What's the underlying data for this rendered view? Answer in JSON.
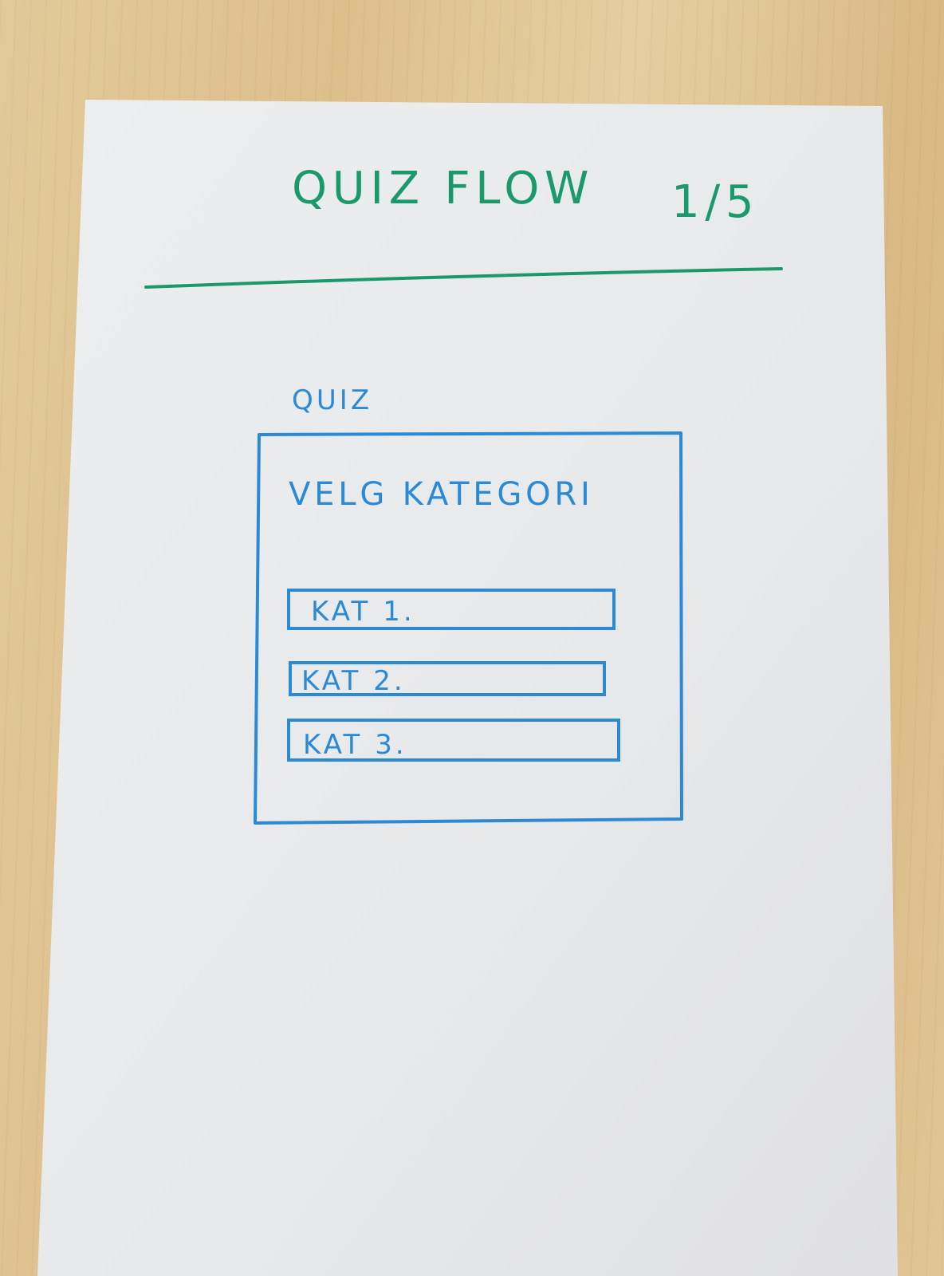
{
  "sheet": {
    "title": "QUIZ FLOW",
    "page_indicator": "1/5"
  },
  "mockup": {
    "app_label": "QUIZ",
    "heading": "VELG KATEGORI",
    "categories": [
      {
        "label": "KAT 1."
      },
      {
        "label": "KAT 2."
      },
      {
        "label": "KAT 3."
      }
    ]
  },
  "colors": {
    "green_marker": "#1a9a6a",
    "blue_marker": "#2a8ad6",
    "paper": "#e9ebee"
  }
}
